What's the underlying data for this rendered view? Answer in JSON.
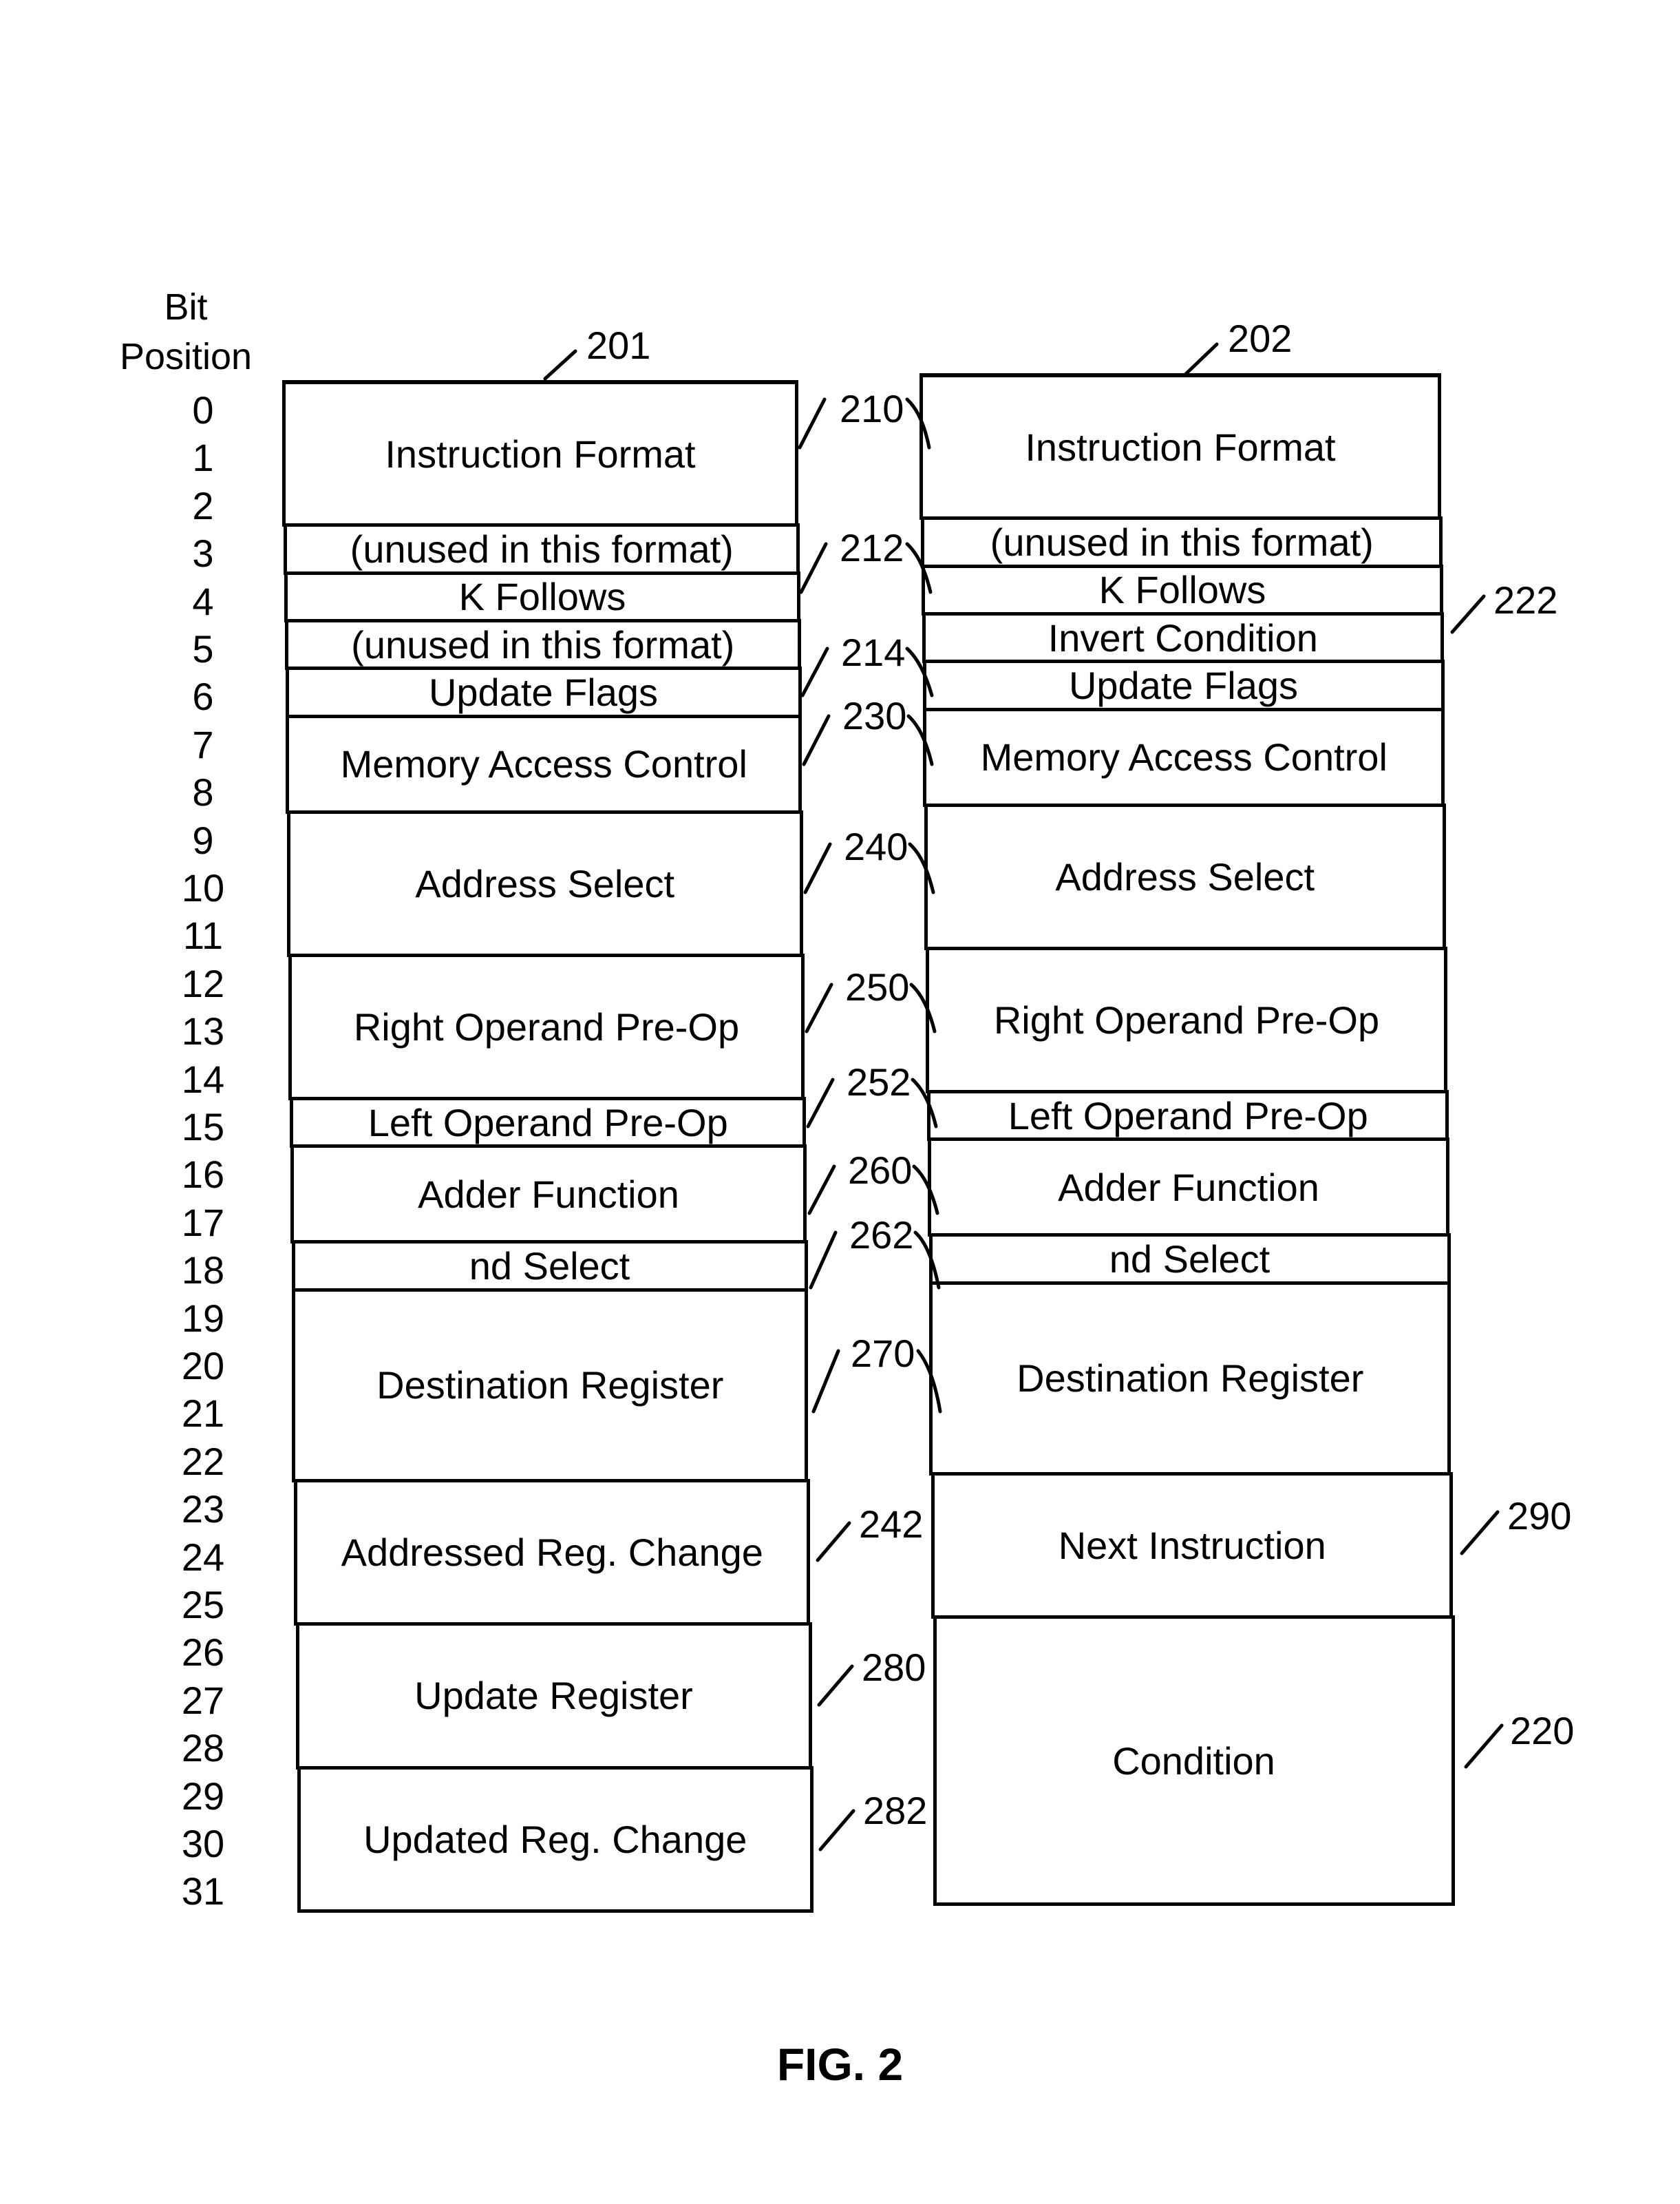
{
  "bit_axis": {
    "header_line1": "Bit",
    "header_line2": "Position",
    "bits": [
      "0",
      "1",
      "2",
      "3",
      "4",
      "5",
      "6",
      "7",
      "8",
      "9",
      "10",
      "11",
      "12",
      "13",
      "14",
      "15",
      "16",
      "17",
      "18",
      "19",
      "20",
      "21",
      "22",
      "23",
      "24",
      "25",
      "26",
      "27",
      "28",
      "29",
      "30",
      "31"
    ]
  },
  "format_201": {
    "ref": "201",
    "fields": [
      {
        "label": "Instruction Format",
        "bits": [
          0,
          2
        ],
        "ref": "210"
      },
      {
        "label": "(unused in this format)",
        "bits": [
          3,
          3
        ],
        "ref": "212"
      },
      {
        "label": "K Follows",
        "bits": [
          4,
          4
        ],
        "ref": ""
      },
      {
        "label": "(unused in this format)",
        "bits": [
          5,
          5
        ],
        "ref": "214"
      },
      {
        "label": "Update Flags",
        "bits": [
          6,
          6
        ],
        "ref": ""
      },
      {
        "label": "Memory Access Control",
        "bits": [
          7,
          8
        ],
        "ref": "230"
      },
      {
        "label": "Address Select",
        "bits": [
          9,
          11
        ],
        "ref": "240"
      },
      {
        "label": "Right Operand Pre-Op",
        "bits": [
          12,
          14
        ],
        "ref": "250"
      },
      {
        "label": "Left Operand Pre-Op",
        "bits": [
          15,
          15
        ],
        "ref": "252"
      },
      {
        "label": "Adder Function",
        "bits": [
          16,
          17
        ],
        "ref": "260"
      },
      {
        "label": "nd Select",
        "bits": [
          18,
          18
        ],
        "ref": "262"
      },
      {
        "label": "Destination Register",
        "bits": [
          19,
          22
        ],
        "ref": "270"
      },
      {
        "label": "Addressed Reg. Change",
        "bits": [
          23,
          25
        ],
        "ref": "242"
      },
      {
        "label": "Update Register",
        "bits": [
          26,
          28
        ],
        "ref": "280"
      },
      {
        "label": "Updated Reg. Change",
        "bits": [
          29,
          31
        ],
        "ref": "282"
      }
    ]
  },
  "format_202": {
    "ref": "202",
    "fields": [
      {
        "label": "Instruction Format",
        "bits": [
          0,
          2
        ]
      },
      {
        "label": "(unused in this format)",
        "bits": [
          3,
          3
        ]
      },
      {
        "label": "K Follows",
        "bits": [
          4,
          4
        ]
      },
      {
        "label": "Invert Condition",
        "bits": [
          5,
          5
        ],
        "ref": "222"
      },
      {
        "label": "Update Flags",
        "bits": [
          6,
          6
        ]
      },
      {
        "label": "Memory Access Control",
        "bits": [
          7,
          8
        ]
      },
      {
        "label": "Address Select",
        "bits": [
          9,
          11
        ]
      },
      {
        "label": "Right Operand Pre-Op",
        "bits": [
          12,
          14
        ]
      },
      {
        "label": "Left Operand Pre-Op",
        "bits": [
          15,
          15
        ]
      },
      {
        "label": "Adder Function",
        "bits": [
          16,
          17
        ]
      },
      {
        "label": "nd Select",
        "bits": [
          18,
          18
        ]
      },
      {
        "label": "Destination Register",
        "bits": [
          19,
          22
        ]
      },
      {
        "label": "Next Instruction",
        "bits": [
          23,
          25
        ],
        "ref": "290"
      },
      {
        "label": "Condition",
        "bits": [
          26,
          31
        ],
        "ref": "220"
      }
    ]
  },
  "figure_caption": "FIG. 2"
}
